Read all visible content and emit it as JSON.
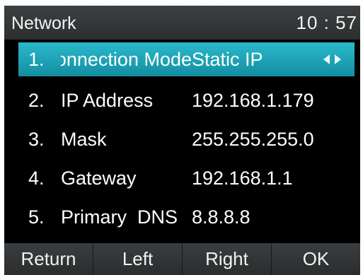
{
  "header": {
    "title": "Network",
    "time": "10 : 57"
  },
  "rows": [
    {
      "num": "1.",
      "label": "Connection Mode",
      "value": "Static IP",
      "selected": true
    },
    {
      "num": "2.",
      "label": "IP Address",
      "value": "192.168.1.179"
    },
    {
      "num": "3.",
      "label": "Mask",
      "value": "255.255.255.0"
    },
    {
      "num": "4.",
      "label": "Gateway",
      "value": "192.168.1.1"
    },
    {
      "num": "5.",
      "label": "Primary  DNS",
      "value": "8.8.8.8"
    }
  ],
  "softkeys": {
    "return": "Return",
    "left": "Left",
    "right": "Right",
    "ok": "OK"
  },
  "icons": {
    "left": "triangle-left-icon",
    "right": "triangle-right-icon"
  },
  "colors": {
    "selection": "#1fa6b8",
    "background": "#000000",
    "bars": "#343738"
  }
}
